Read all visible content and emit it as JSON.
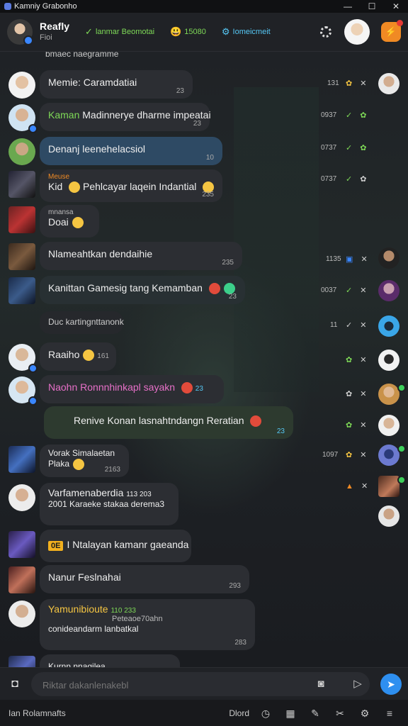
{
  "titlebar": {
    "title": "Kamniy Grabonho",
    "minimize": "—",
    "maximize": "☐",
    "close": "✕"
  },
  "header": {
    "user_name": "Reafly",
    "user_sub": "Fioi",
    "chips": [
      {
        "icon": "✓",
        "label": "lanmar Beomotai",
        "color": "#7ed957"
      },
      {
        "icon": "😃",
        "label": "15080",
        "color": "#7ed957"
      },
      {
        "icon": "⚙",
        "label": "Iomeicmeit",
        "color": "#56c8f5"
      }
    ]
  },
  "chat": {
    "top_partial": "bmaec naegramme",
    "messages": [
      {
        "name": "Memie: Caramdatiai",
        "time": "23"
      },
      {
        "name": "Kaman",
        "text": "Madinnerye dharme impeatai",
        "time": "23"
      },
      {
        "name": "Denanj leenehelacsiol",
        "time": "10"
      },
      {
        "name": "Kid",
        "label": "Meuse",
        "text": "Pehlcayar laqein Indantial",
        "time": "235"
      },
      {
        "label": "mnansa",
        "text": "Doai"
      },
      {
        "text": "Nlameahtkan dendaihie",
        "time": "235"
      },
      {
        "text": "Kanittan Gamesig tang Kemamban",
        "time": "23"
      },
      {
        "text": "Duc kartingnttanonk"
      },
      {
        "text": "Raaiho",
        "time": "161"
      },
      {
        "text": "Naohn Ronnnhinkapl sayakn",
        "time": "23"
      },
      {
        "text": "Renive Konan lasnahtndangn Reratian",
        "time": "23"
      },
      {
        "name": "Vorak Simalaetan",
        "text": "Plaka",
        "time": "2163"
      },
      {
        "name": "Varfamenaberdia",
        "meta": "113 203",
        "text": "2001 Karaeke stakaa derema3"
      },
      {
        "tag": "0E",
        "text": "I Ntalayan kamanr gaeanda"
      },
      {
        "text": "Nanur Feslnahai",
        "time": "293"
      },
      {
        "name": "Yamunibioute",
        "meta": "110 233",
        "sub": "Peteaoe70ahn",
        "text": "conideandarm lanbatkal",
        "time": "283"
      },
      {
        "text": "Kurnn nnaqilea"
      }
    ],
    "side_times": [
      "131",
      "0937",
      "0737",
      "0737",
      "1135",
      "0037",
      "11",
      "1097"
    ]
  },
  "composer": {
    "placeholder": "Riktar dakanlenakebl"
  },
  "statusbar": {
    "left": "Ian Rolamnafts",
    "right_label": "Dlord"
  }
}
